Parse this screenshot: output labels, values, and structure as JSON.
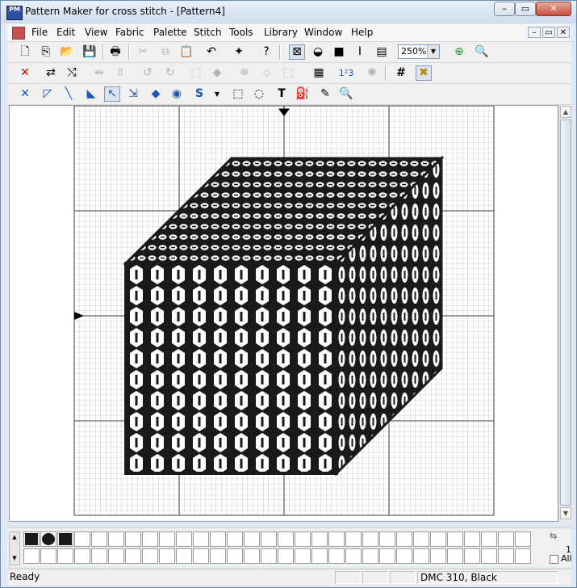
{
  "window": {
    "app_icon": "PM",
    "title": "Pattern Maker for cross stitch - [Pattern4]",
    "min": "–",
    "max": "▭",
    "close": "✕"
  },
  "menu": [
    "File",
    "Edit",
    "View",
    "Fabric",
    "Palette",
    "Stitch",
    "Tools",
    "Library",
    "Window",
    "Help"
  ],
  "mdi_buttons": [
    "–",
    "▭",
    "✕"
  ],
  "toolbar1": {
    "zoom": "250%"
  },
  "palette": {
    "swatches": [
      {
        "shape": "square",
        "color": "#1a1a1a"
      },
      {
        "shape": "round",
        "color": "#1a1a1a"
      },
      {
        "shape": "square",
        "color": "#1a1a1a"
      }
    ],
    "count": "1",
    "all_label": "All"
  },
  "status": {
    "left": "Ready",
    "thread": "DMC  310, Black"
  },
  "colors": {
    "ink": "#1a1a1a",
    "grid": "#9b9b9b",
    "major_grid": "#3a3a3a"
  }
}
